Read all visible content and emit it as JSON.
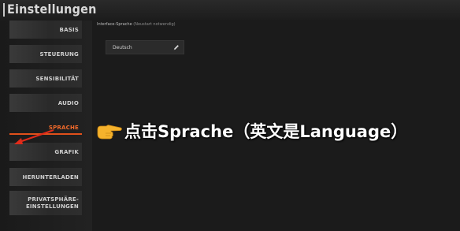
{
  "window": {
    "title": "Einstellungen"
  },
  "sidebar": {
    "items": [
      {
        "label": "BASIS",
        "active": false
      },
      {
        "label": "STEUERUNG",
        "active": false
      },
      {
        "label": "SENSIBILITÄT",
        "active": false
      },
      {
        "label": "AUDIO",
        "active": false
      },
      {
        "label": "SPRACHE",
        "active": true
      },
      {
        "label": "GRAFIK",
        "active": false
      },
      {
        "label": "HERUNTERLADEN",
        "active": false
      },
      {
        "label": "PRIVATSPHÄRE-\nEINSTELLUNGEN",
        "active": false
      }
    ]
  },
  "main": {
    "section_label": "Interface-Sprache",
    "section_hint": "(Neustart notwendig)",
    "language_value": "Deutsch"
  },
  "annotation": {
    "text": "点击Sprache（英文是Language）"
  },
  "colors": {
    "accent": "#e0501b",
    "active_text": "#f26a2a",
    "annotation_arrow": "#e02b1a"
  },
  "icons": {
    "edit": "pencil-icon",
    "pointer": "pointing-hand-icon"
  }
}
